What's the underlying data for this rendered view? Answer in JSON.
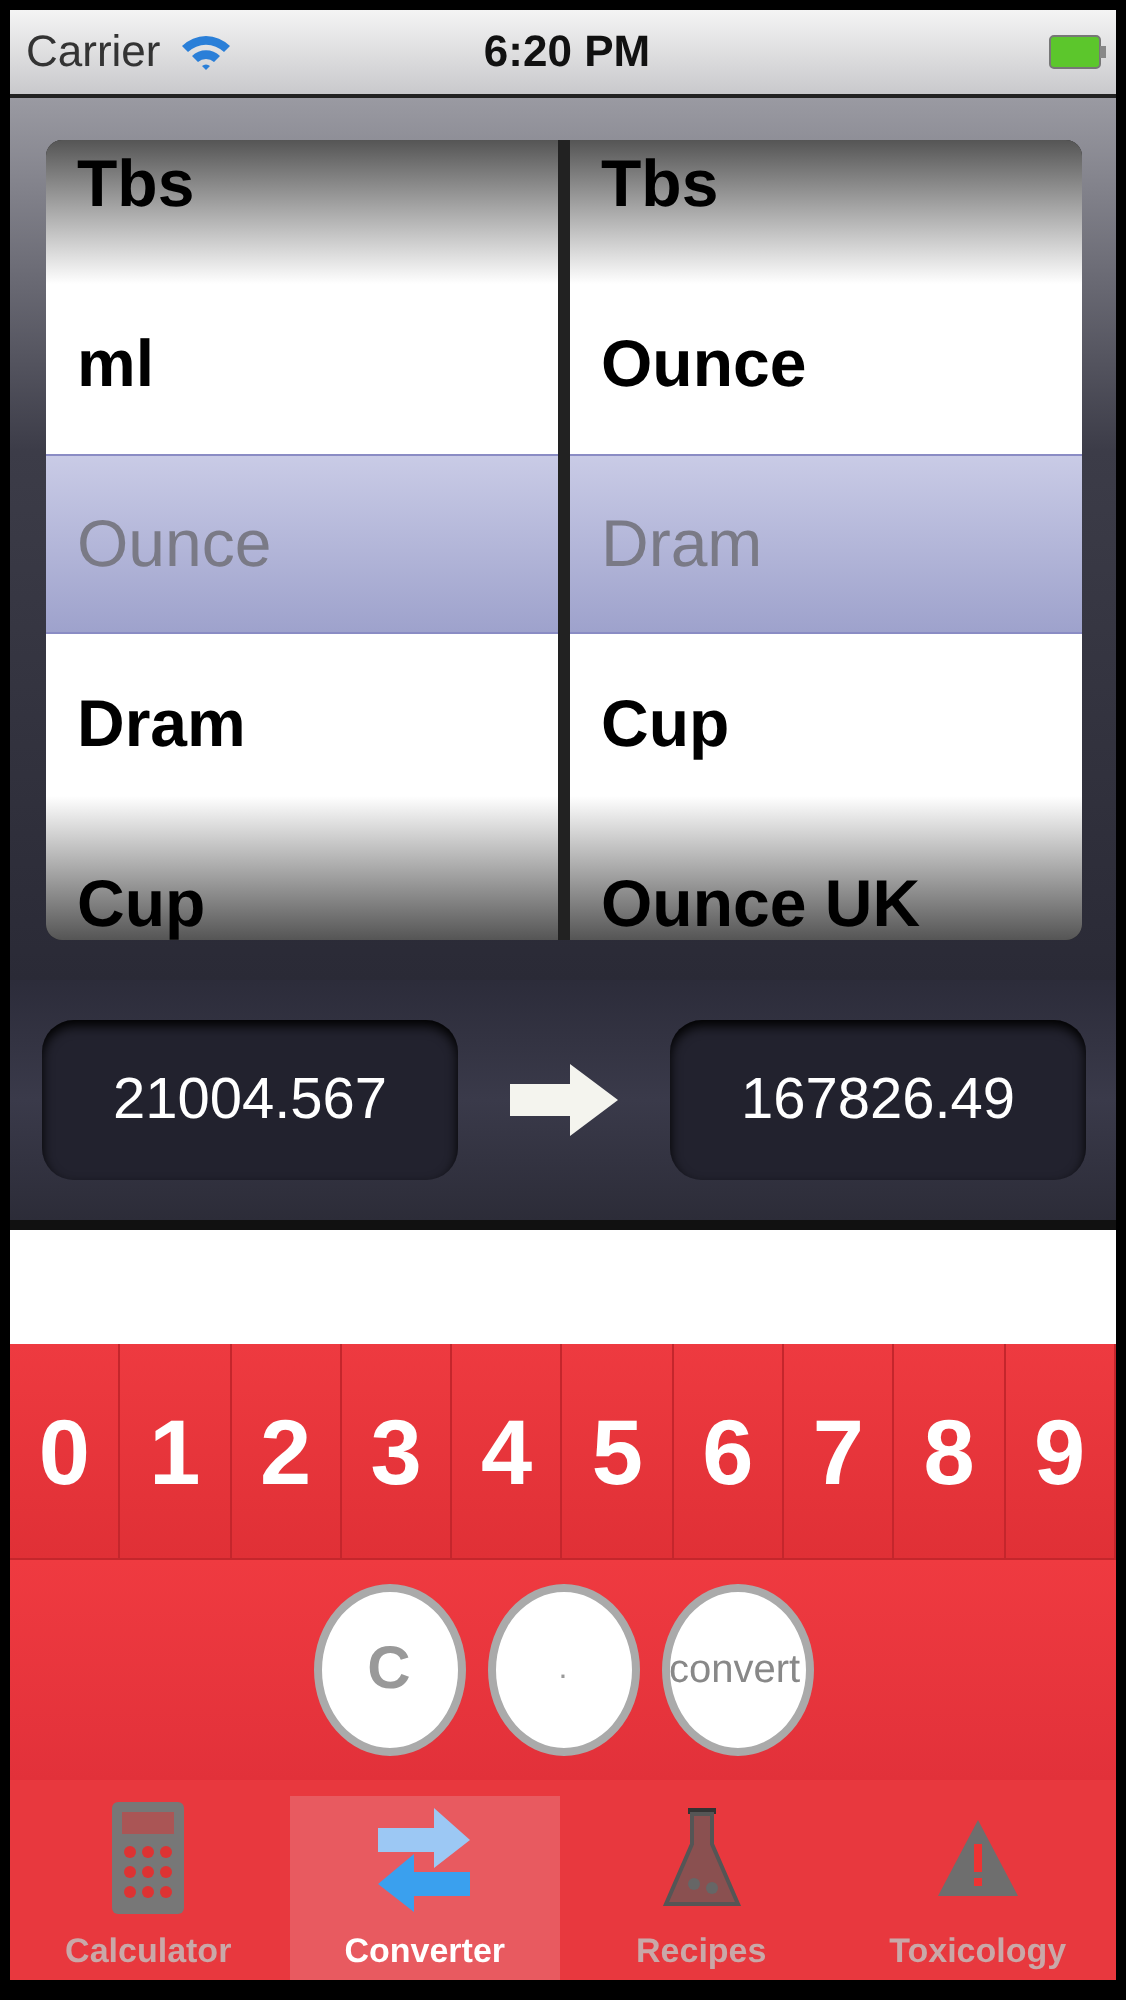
{
  "status_bar": {
    "carrier": "Carrier",
    "time": "6:20 PM"
  },
  "picker": {
    "columns": [
      {
        "rows": [
          {
            "label": "Tbs",
            "selected": false
          },
          {
            "label": "ml",
            "selected": false
          },
          {
            "label": "Ounce",
            "selected": true
          },
          {
            "label": "Dram",
            "selected": false
          },
          {
            "label": "Cup",
            "selected": false
          }
        ]
      },
      {
        "rows": [
          {
            "label": "Tbs",
            "selected": false
          },
          {
            "label": "Ounce",
            "selected": false
          },
          {
            "label": "Dram",
            "selected": true
          },
          {
            "label": "Cup",
            "selected": false
          },
          {
            "label": "Ounce UK",
            "selected": false
          }
        ]
      }
    ]
  },
  "conversion": {
    "input": "21004.567",
    "output": "167826.49"
  },
  "digit_keys": [
    "0",
    "1",
    "2",
    "3",
    "4",
    "5",
    "6",
    "7",
    "8",
    "9"
  ],
  "action_keys": [
    {
      "label": "C",
      "kind": "clear"
    },
    {
      "label": ".",
      "kind": "dot"
    },
    {
      "label": "convert",
      "kind": "convert"
    }
  ],
  "tabs": [
    {
      "label": "Calculator",
      "kind": "calculator",
      "selected": false
    },
    {
      "label": "Converter",
      "kind": "converter",
      "selected": true
    },
    {
      "label": "Recipes",
      "kind": "recipes",
      "selected": false
    },
    {
      "label": "Toxicology",
      "kind": "toxicology",
      "selected": false
    }
  ]
}
